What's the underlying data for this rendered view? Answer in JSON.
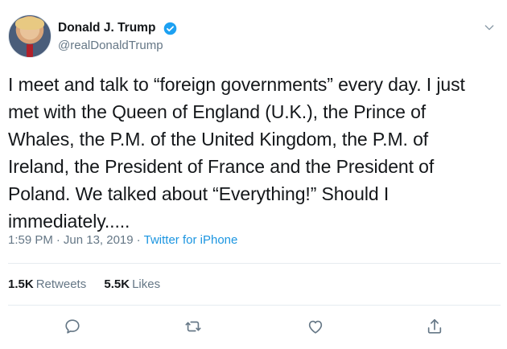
{
  "author": {
    "display_name": "Donald J. Trump",
    "handle": "@realDonaldTrump",
    "verified": true
  },
  "tweet": {
    "text": "I meet and talk to “foreign governments” every day. I just\nmet with the Queen of England (U.K.), the Prince of\nWhales, the P.M. of the United Kingdom, the P.M. of\nIreland, the President of France and the President of\nPoland. We talked about “Everything!” Should I\nimmediately.....",
    "time": "1:59 PM",
    "date": "Jun 13, 2019",
    "source": "Twitter for iPhone",
    "separator": "·"
  },
  "stats": {
    "retweets_count": "1.5K",
    "retweets_label": "Retweets",
    "likes_count": "5.5K",
    "likes_label": "Likes"
  },
  "icons": {
    "reply": "reply-icon",
    "retweet": "retweet-icon",
    "like": "like-icon",
    "share": "share-icon",
    "more": "chevron-down-icon",
    "verified": "verified-badge-icon"
  },
  "colors": {
    "text": "#14171a",
    "secondary": "#657786",
    "link": "#1b95e0",
    "verified": "#1da1f2",
    "divider": "#e6ecf0"
  }
}
